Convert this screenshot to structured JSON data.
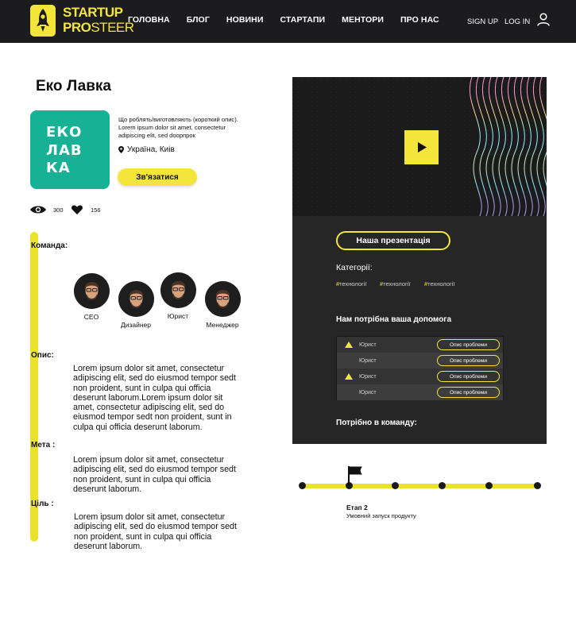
{
  "header": {
    "brand_line1": "STARTUP",
    "brand_line2_bold": "PRO",
    "brand_line2_thin": "STEER",
    "nav": [
      "ГОЛОВНА",
      "БЛОГ",
      "НОВИНИ",
      "СТАРТАПИ",
      "МЕНТОРИ",
      "ПРО НАС"
    ],
    "sign_up": "SIGN UP",
    "log_in": "LOG IN",
    "user_icon": "user-icon"
  },
  "project": {
    "title": "Еко Лавка",
    "logo_lines": [
      "ЕКО",
      "ЛАВ",
      "КА"
    ],
    "short_description": "Що роблять/виготовляють (короткий опис). Lorem ipsum dolor sit amet, consectetur adipiscing elit, sed doорпрок",
    "location": "Україна, Киів",
    "contact_label": "Зв'язатися",
    "views": "300",
    "likes": "156"
  },
  "team": {
    "label": "Команда:",
    "members": [
      {
        "role": "CEO"
      },
      {
        "role": "Дизайнер"
      },
      {
        "role": "Юрист"
      },
      {
        "role": "Менеджер"
      }
    ]
  },
  "sections": {
    "description_label": "Опис:",
    "description_text": "Lorem ipsum dolor sit amet, consectetur adipiscing elit, sed do eiusmod tempor sedt non proident, sunt in culpa qui officia deserunt laborum.Lorem ipsum dolor sit amet, consectetur adipiscing elit, sed do eiusmod tempor sedt non proident, sunt in culpa qui officia deserunt laborum.",
    "goal_label": "Мета :",
    "goal_text": "Lorem ipsum dolor sit amet, consectetur adipiscing elit, sed do eiusmod tempor sedt non proident, sunt in culpa qui officia deserunt laborum.",
    "aim_label": "Ціль :",
    "aim_text": "Lorem ipsum dolor sit amet, consectetur adipiscing elit, sed do eiusmod tempor sedt non proident, sunt in culpa qui officia deserunt laborum."
  },
  "panel": {
    "presentation_label": "Наша презентація",
    "categories_label": "Категорії:",
    "tags": [
      "технології",
      "технології",
      "технології"
    ],
    "help_title": "Нам потрібна ваша допомога",
    "help_rows": [
      {
        "role": "Юрист",
        "button": "Опис проблеми",
        "warning": true
      },
      {
        "role": "Юрист",
        "button": "Опис проблеми",
        "warning": false
      },
      {
        "role": "Юрист",
        "button": "Опис проблеми",
        "warning": true
      },
      {
        "role": "Юрист",
        "button": "Опис проблеми",
        "warning": false
      }
    ],
    "team_need_label": "Потрібно в команду:"
  },
  "timeline": {
    "stage_title": "Етап 2",
    "stage_description": "Умовний запуск продукту"
  },
  "colors": {
    "accent": "#f4e53a",
    "brand_green": "#17b295",
    "dark": "#1c1c1e"
  }
}
